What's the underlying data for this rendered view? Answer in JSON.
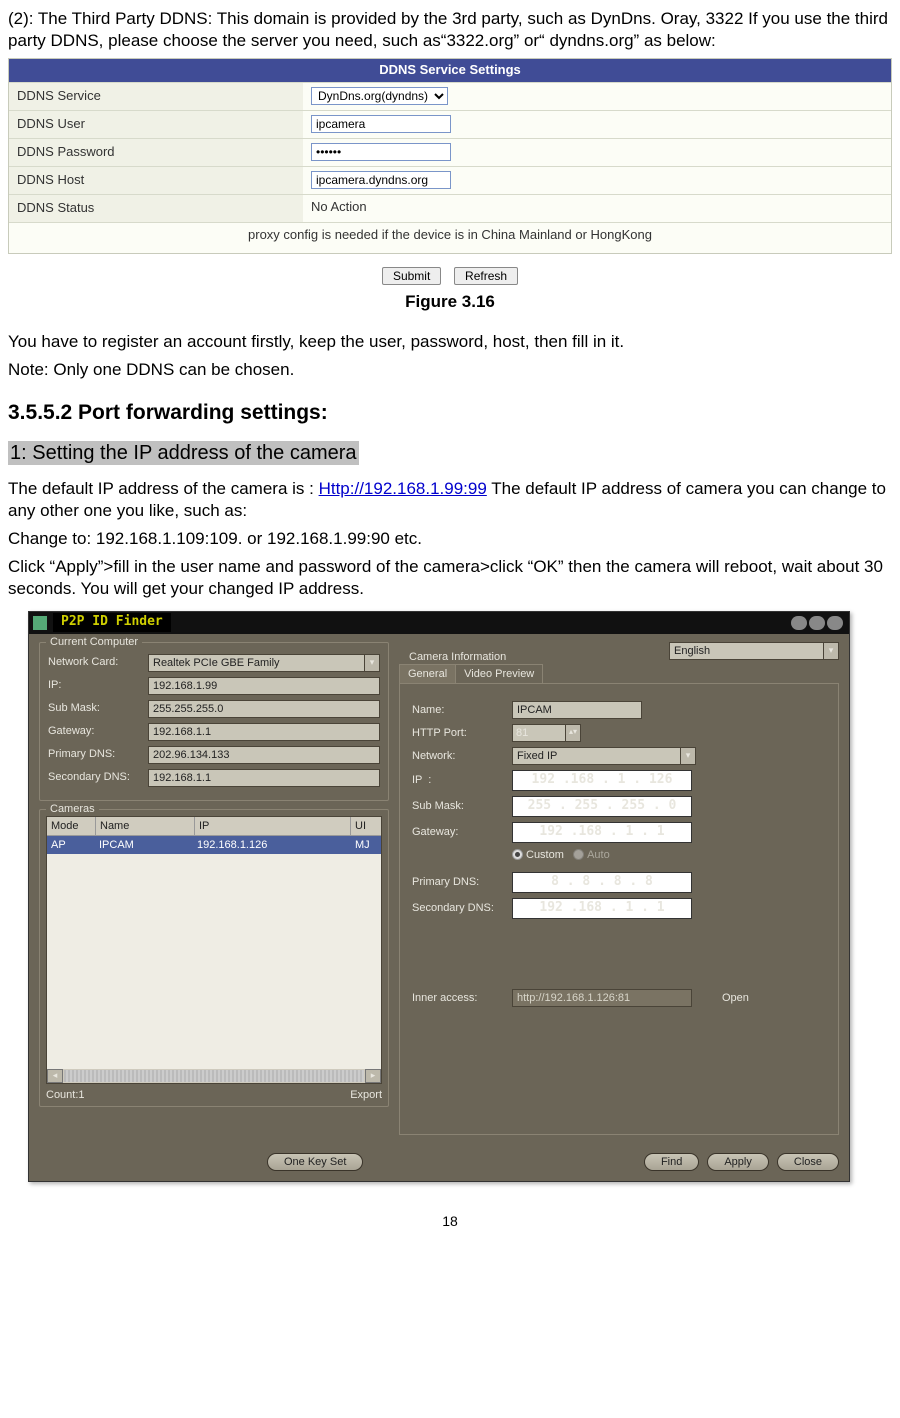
{
  "intro": "(2): The Third Party DDNS: This domain is provided by the 3rd party, such as DynDns. Oray, 3322 If you use the third party DDNS, please choose the server you need, such as“3322.org” or“ dyndns.org” as below:",
  "ddns": {
    "title": "DDNS Service Settings",
    "rows": {
      "service_label": "DDNS Service",
      "service_value": "DynDns.org(dyndns)",
      "user_label": "DDNS User",
      "user_value": "ipcamera",
      "pass_label": "DDNS Password",
      "pass_value": "••••••",
      "host_label": "DDNS Host",
      "host_value": "ipcamera.dyndns.org",
      "status_label": "DDNS Status",
      "status_value": "No Action"
    },
    "note": "proxy config is needed if the device is in China Mainland or HongKong",
    "submit": "Submit",
    "refresh": "Refresh"
  },
  "figure_caption": "Figure 3.16",
  "register_note": "You have to register an account firstly, keep the user, password, host, then fill in it.",
  "ddns_note": "Note: Only one DDNS can be chosen.",
  "h2": "3.5.5.2 Port forwarding settings:",
  "subhead": "1: Setting the IP address of the camera",
  "ippara_pre": "The default IP address of the camera is : ",
  "ip_link": "Http://192.168.1.99:99",
  "ippara_post": " The default IP address of camera you can change to any other one you like, such as:",
  "change_line": "Change to: 192.168.1.109:109. or 192.168.1.99:90 etc.",
  "apply_line": "Click “Apply”>fill in the user name and password of the camera>click “OK” then the camera will reboot, wait about 30 seconds. You will get your changed IP address.",
  "finder": {
    "title": "P2P ID Finder",
    "lang": "English",
    "left": {
      "computer_legend": "Current Computer",
      "net_card_l": "Network Card:",
      "net_card_v": "Realtek PCIe GBE Family",
      "ip_l": "IP:",
      "ip_v": "192.168.1.99",
      "sub_l": "Sub Mask:",
      "sub_v": "255.255.255.0",
      "gw_l": "Gateway:",
      "gw_v": "192.168.1.1",
      "pdns_l": "Primary DNS:",
      "pdns_v": "202.96.134.133",
      "sdns_l": "Secondary DNS:",
      "sdns_v": "192.168.1.1",
      "cameras_legend": "Cameras",
      "col_mode": "Mode",
      "col_name": "Name",
      "col_ip": "IP",
      "col_ui": "UI",
      "row_mode": "AP",
      "row_name": "IPCAM",
      "row_ip": "192.168.1.126",
      "row_ui": "MJ",
      "count": "Count:1",
      "export": "Export"
    },
    "right": {
      "cam_info_legend": "Camera Information",
      "tab_general": "General",
      "tab_preview": "Video Preview",
      "name_l": "Name:",
      "name_v": "IPCAM",
      "port_l": "HTTP Port:",
      "port_v": "81",
      "net_l": "Network:",
      "net_v": "Fixed IP",
      "ip_l": "IP  :",
      "ip_v": "192 .168 .  1  . 126",
      "sub_l": "Sub Mask:",
      "sub_v": "255 . 255 . 255 .  0",
      "gw_l": "Gateway:",
      "gw_v": "192 .168 .  1  .  1",
      "radio_custom": "Custom",
      "radio_auto": "Auto",
      "pdns_l": "Primary DNS:",
      "pdns_v": " 8  . 8  . 8  . 8",
      "sdns_l": "Secondary DNS:",
      "sdns_v": "192 .168 .  1  .  1",
      "inner_l": "Inner access:",
      "inner_v": "http://192.168.1.126:81",
      "open": "Open"
    },
    "btns": {
      "onekey": "One Key Set",
      "find": "Find",
      "apply": "Apply",
      "close": "Close"
    }
  },
  "page_number": "18"
}
